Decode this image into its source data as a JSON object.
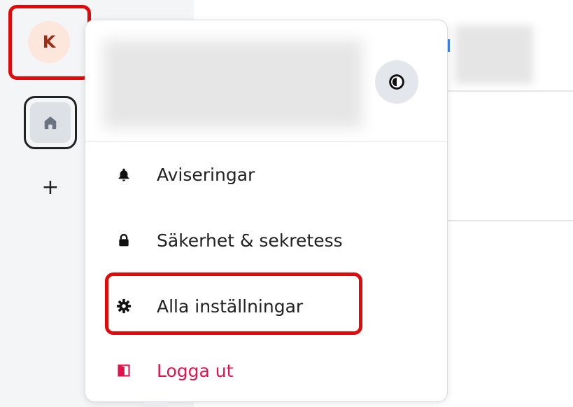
{
  "sidebar": {
    "avatar_initial": "K",
    "add_label": "+"
  },
  "menu": {
    "items": [
      {
        "label": "Aviseringar",
        "icon": "bell-icon"
      },
      {
        "label": "Säkerhet & sekretess",
        "icon": "lock-icon"
      },
      {
        "label": "Alla inställningar",
        "icon": "gear-icon"
      },
      {
        "label": "Logga ut",
        "icon": "logout-icon"
      }
    ]
  },
  "colors": {
    "highlight": "#e00a0a",
    "logout": "#e0144c",
    "avatar_bg": "#fde6dc",
    "avatar_text": "#9a2d12"
  }
}
